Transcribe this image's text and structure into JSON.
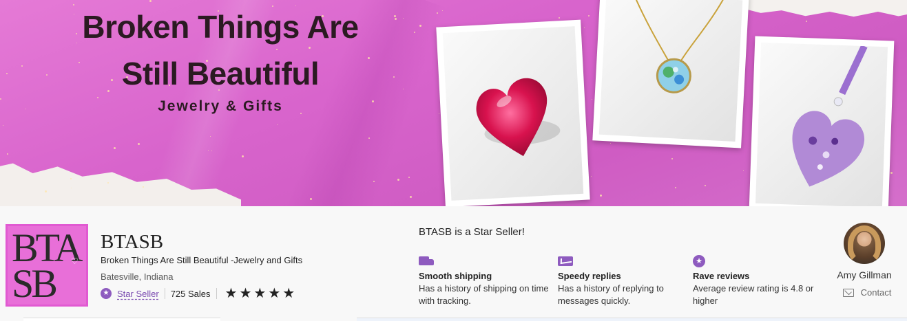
{
  "banner": {
    "title_line1": "Broken Things Are",
    "title_line2": "Still Beautiful",
    "subtitle": "Jewelry & Gifts",
    "photos": [
      "red-resin-heart",
      "blue-green-pendant-necklace",
      "purple-heart-ornament"
    ]
  },
  "shop": {
    "logo_letters": "BTASB",
    "name": "BTASB",
    "tagline": "Broken Things Are Still Beautiful -Jewelry and Gifts",
    "location": "Batesville, Indiana",
    "star_seller_label": "Star Seller",
    "sales": "725 Sales",
    "rating_stars": 5
  },
  "star_seller": {
    "headline": "BTASB is a Star Seller!",
    "features": [
      {
        "icon": "truck-icon",
        "title": "Smooth shipping",
        "desc": "Has a history of shipping on time with tracking."
      },
      {
        "icon": "envelope-icon",
        "title": "Speedy replies",
        "desc": "Has a history of replying to messages quickly."
      },
      {
        "icon": "star-badge-icon",
        "title": "Rave reviews",
        "desc": "Average review rating is 4.8 or higher"
      }
    ]
  },
  "owner": {
    "name": "Amy Gillman",
    "contact_label": "Contact"
  },
  "colors": {
    "banner_pink": "#d864cc",
    "accent_purple": "#8e5bbf",
    "logo_pink": "#e86fd8"
  }
}
